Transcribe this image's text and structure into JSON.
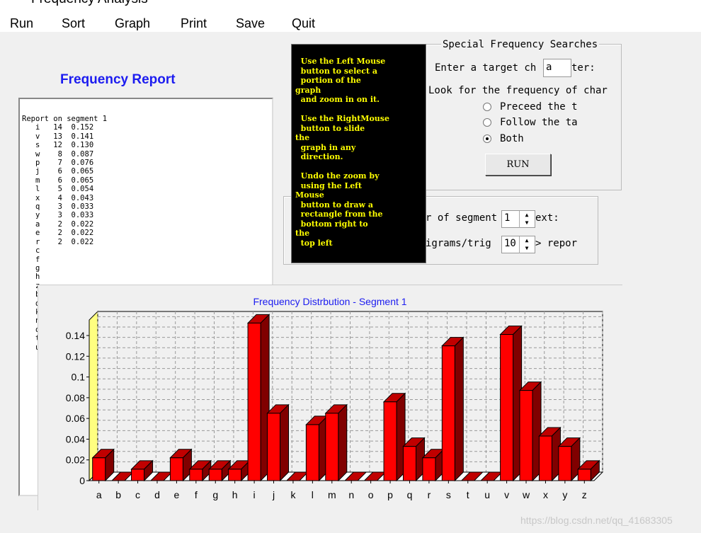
{
  "window": {
    "title": "Frequency Analysis"
  },
  "menu": [
    "Run",
    "Sort",
    "Graph",
    "Print",
    "Save",
    "Quit"
  ],
  "report": {
    "title": "Frequency Report",
    "header": "Report on segment 1",
    "rows": [
      [
        "i",
        "14",
        "0.152"
      ],
      [
        "v",
        "13",
        "0.141"
      ],
      [
        "s",
        "12",
        "0.130"
      ],
      [
        "w",
        "8",
        "0.087"
      ],
      [
        "p",
        "7",
        "0.076"
      ],
      [
        "j",
        "6",
        "0.065"
      ],
      [
        "m",
        "6",
        "0.065"
      ],
      [
        "l",
        "5",
        "0.054"
      ],
      [
        "x",
        "4",
        "0.043"
      ],
      [
        "q",
        "3",
        "0.033"
      ],
      [
        "y",
        "3",
        "0.033"
      ],
      [
        "a",
        "2",
        "0.022"
      ],
      [
        "e",
        "2",
        "0.022"
      ],
      [
        "r",
        "2",
        "0.022"
      ],
      [
        "c",
        "",
        ""
      ],
      [
        "f",
        "",
        ""
      ],
      [
        "g",
        "",
        ""
      ],
      [
        "h",
        "",
        ""
      ],
      [
        "z",
        "",
        ""
      ],
      [
        "b",
        "",
        ""
      ],
      [
        "d",
        "",
        ""
      ],
      [
        "k",
        "",
        ""
      ],
      [
        "n",
        "",
        ""
      ],
      [
        "o",
        "",
        ""
      ],
      [
        "t",
        "",
        ""
      ],
      [
        "u",
        "",
        ""
      ]
    ]
  },
  "help": {
    "text": "  Use the Left Mouse\n  button to select a\n  portion of the\ngraph\n  and zoom in on it.\n\n  Use the RightMouse\n  button to slide\nthe\n  graph in any\n  direction.\n\n  Undo the zoom by\n  using the Left\nMouse\n  button to draw a\n  rectangle from the\n  bottom right to\nthe\n  top left"
  },
  "special": {
    "title": "Special Frequency Searches",
    "target_label_a": "Enter a target ch",
    "target_value": "a",
    "target_label_b": "ter:",
    "look_label": "Look for the frequency of char",
    "options": [
      {
        "label": "Preceed the t",
        "selected": false
      },
      {
        "label": "Follow the ta",
        "selected": false
      },
      {
        "label": "Both",
        "selected": true
      }
    ],
    "run_label": "RUN"
  },
  "segment": {
    "label_a": "r of segment",
    "value": "1",
    "label_b": "ext:",
    "bigram_label_a": "igrams/trig",
    "bigram_value": "10",
    "bigram_label_b": "> repor"
  },
  "chart_data": {
    "type": "bar",
    "title": "Frequency Distrbution - Segment 1",
    "categories": [
      "a",
      "b",
      "c",
      "d",
      "e",
      "f",
      "g",
      "h",
      "i",
      "j",
      "k",
      "l",
      "m",
      "n",
      "o",
      "p",
      "q",
      "r",
      "s",
      "t",
      "u",
      "v",
      "w",
      "x",
      "y",
      "z"
    ],
    "values": [
      0.022,
      0,
      0.011,
      0,
      0.022,
      0.011,
      0.011,
      0.011,
      0.152,
      0.065,
      0,
      0.054,
      0.065,
      0,
      0,
      0.076,
      0.033,
      0.022,
      0.13,
      0,
      0,
      0.141,
      0.087,
      0.043,
      0.033,
      0.011
    ],
    "yticks": [
      "0",
      "0.02",
      "0.04",
      "0.06",
      "0.08",
      "0.1",
      "0.12",
      "0.14"
    ],
    "ylim": [
      0,
      0.155
    ],
    "grid": true,
    "style": "3d",
    "colors": {
      "bar": "#ff0000",
      "bar_side": "#800000",
      "bar_top": "#c00000",
      "title": "#1c1cf0",
      "wall": "#ffff80"
    }
  },
  "watermark": "https://blog.csdn.net/qq_41683305"
}
